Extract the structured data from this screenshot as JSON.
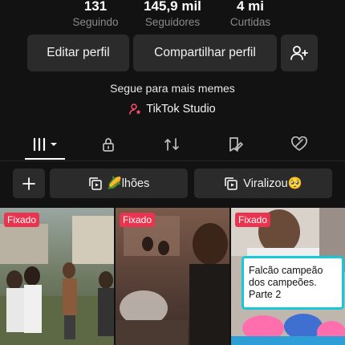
{
  "stats": [
    {
      "value": "131",
      "label": "Seguindo"
    },
    {
      "value": "145,9 mil",
      "label": "Seguidores"
    },
    {
      "value": "4 mi",
      "label": "Curtidas"
    }
  ],
  "actions": {
    "edit_label": "Editar perfil",
    "share_label": "Compartilhar perfil",
    "add_friend_icon": "person-plus-icon"
  },
  "bio": "Segue para mais memes",
  "studio_link": "TikTok Studio",
  "tabs": [
    {
      "icon": "videos-grid-icon",
      "selected": true
    },
    {
      "icon": "lock-icon"
    },
    {
      "icon": "repost-icon"
    },
    {
      "icon": "favorites-icon"
    },
    {
      "icon": "liked-icon"
    }
  ],
  "playlists": [
    {
      "label": "🌽lhões"
    },
    {
      "label": "Viralizou🥺"
    }
  ],
  "videos": [
    {
      "badge": "Fixado"
    },
    {
      "badge": "Fixado"
    },
    {
      "badge": "Fixado",
      "caption": "Falcão campeão dos campeões. Parte 2"
    }
  ],
  "colors": {
    "background": "#121212",
    "button": "#2b2b2b",
    "pinned_badge": "#e8344e",
    "caption_border": "#18c7d9"
  }
}
